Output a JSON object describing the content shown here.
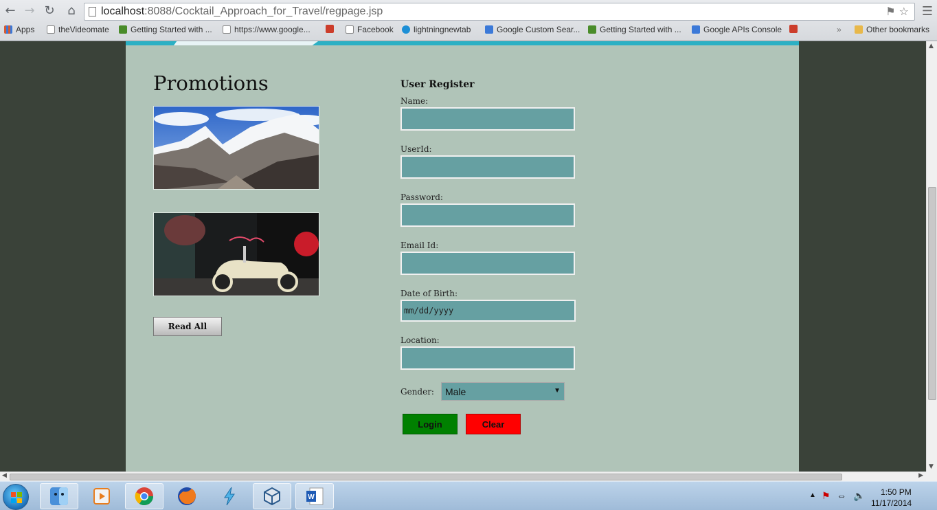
{
  "browser": {
    "url_host": "localhost",
    "url_path": ":8088/Cocktail_Approach_for_Travel/regpage.jsp",
    "bookmarks": [
      {
        "label": "Apps",
        "color": "#d65a31"
      },
      {
        "label": "theVideomate",
        "color": "#ffffff"
      },
      {
        "label": "Getting Started with ...",
        "color": "#4a8c2a"
      },
      {
        "label": "https://www.google...",
        "color": "#ffffff"
      },
      {
        "label": "",
        "color": "#cc3d2b"
      },
      {
        "label": "Facebook",
        "color": "#ffffff"
      },
      {
        "label": "lightningnewtab",
        "color": "#1c8fd6"
      },
      {
        "label": "Google Custom Sear...",
        "color": "#3b79d8"
      },
      {
        "label": "Getting Started with ...",
        "color": "#4a8c2a"
      },
      {
        "label": "Google APIs Console",
        "color": "#3b79d8"
      },
      {
        "label": "",
        "color": "#cc3d2b"
      }
    ],
    "other_bookmarks": "Other bookmarks",
    "overflow": "»"
  },
  "promotions": {
    "title": "Promotions",
    "read_all": "Read All"
  },
  "register": {
    "title": "User Register",
    "fields": [
      {
        "label": "Name:",
        "value": ""
      },
      {
        "label": "UserId:",
        "value": ""
      },
      {
        "label": "Password:",
        "value": ""
      },
      {
        "label": "Email Id:",
        "value": ""
      },
      {
        "label": "Date of Birth:",
        "value": "mm/dd/yyyy"
      },
      {
        "label": "Location:",
        "value": ""
      }
    ],
    "gender_label": "Gender:",
    "gender_value": "Male",
    "login": "Login",
    "clear": "Clear"
  },
  "taskbar": {
    "time": "1:50 PM",
    "date": "11/17/2014"
  },
  "colors": {
    "content_bg": "#b0c4b8",
    "input_bg": "#66a0a2",
    "login": "#008000",
    "clear": "#ff0000",
    "accent": "#2bb0c4"
  }
}
